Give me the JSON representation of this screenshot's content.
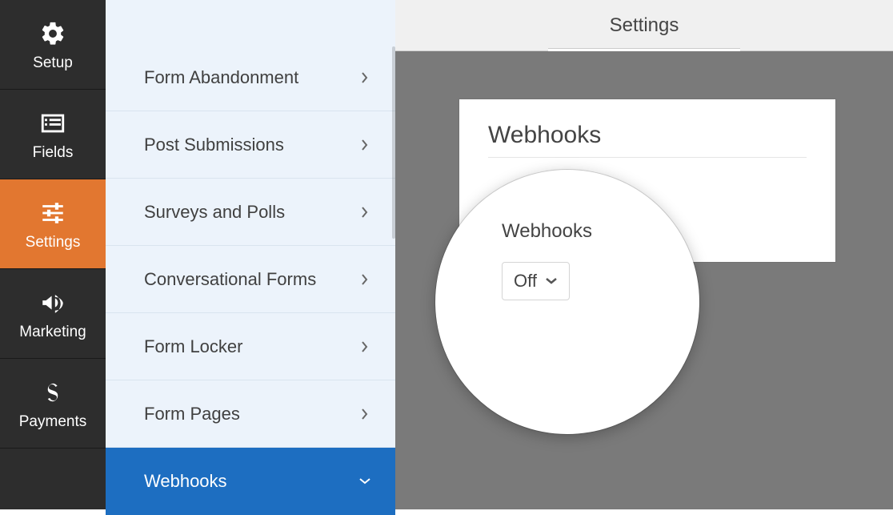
{
  "topbar": {
    "title": "Settings"
  },
  "iconbar": {
    "items": [
      {
        "label": "Setup",
        "icon": "gear-icon"
      },
      {
        "label": "Fields",
        "icon": "list-icon"
      },
      {
        "label": "Settings",
        "icon": "sliders-icon"
      },
      {
        "label": "Marketing",
        "icon": "megaphone-icon"
      },
      {
        "label": "Payments",
        "icon": "dollar-icon"
      }
    ]
  },
  "settings_list": {
    "items": [
      {
        "label": "Form Abandonment"
      },
      {
        "label": "Post Submissions"
      },
      {
        "label": "Surveys and Polls"
      },
      {
        "label": "Conversational Forms"
      },
      {
        "label": "Form Locker"
      },
      {
        "label": "Form Pages"
      },
      {
        "label": "Webhooks"
      }
    ]
  },
  "card": {
    "title": "Webhooks"
  },
  "magnifier": {
    "label": "Webhooks",
    "dropdown_value": "Off"
  }
}
